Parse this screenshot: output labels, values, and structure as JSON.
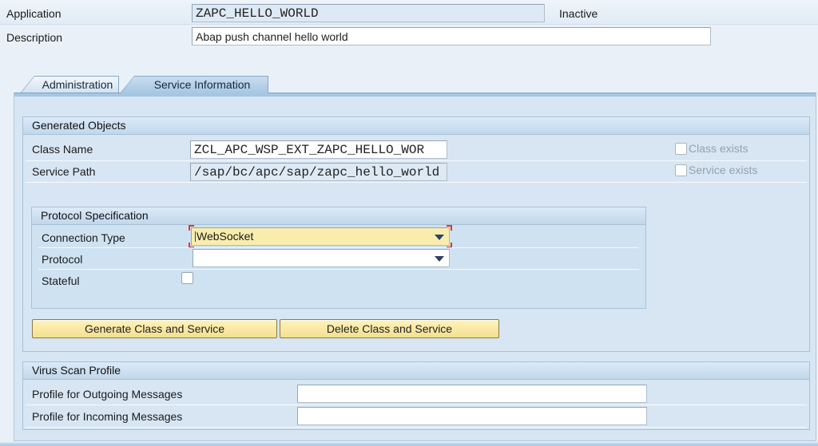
{
  "header": {
    "application_label": "Application",
    "application_value": "ZAPC_HELLO_WORLD",
    "status": "Inactive",
    "description_label": "Description",
    "description_value": "Abap push channel hello world"
  },
  "tabs": [
    {
      "label": "Administration",
      "active": false
    },
    {
      "label": "Service Information",
      "active": true
    }
  ],
  "generated_objects": {
    "title": "Generated Objects",
    "class_name_label": "Class Name",
    "class_name_value": "ZCL_APC_WSP_EXT_ZAPC_HELLO_WOR",
    "service_path_label": "Service Path",
    "service_path_value": "/sap/bc/apc/sap/zapc_hello_world",
    "class_exists_label": "Class exists",
    "class_exists_checked": false,
    "service_exists_label": "Service exists",
    "service_exists_checked": false
  },
  "protocol_specification": {
    "title": "Protocol Specification",
    "connection_type_label": "Connection Type",
    "connection_type_value": "WebSocket",
    "protocol_label": "Protocol",
    "protocol_value": "",
    "stateful_label": "Stateful",
    "stateful_checked": false
  },
  "actions": {
    "generate_label": "Generate Class and Service",
    "delete_label": "Delete Class and Service"
  },
  "virus_scan": {
    "title": "Virus Scan Profile",
    "outgoing_label": "Profile for Outgoing Messages",
    "outgoing_value": "",
    "incoming_label": "Profile for Incoming Messages",
    "incoming_value": ""
  },
  "colors": {
    "panel_bg": "#d8e6f3",
    "focus_field_bg": "#f9edad",
    "focus_bracket_red": "#e2382a",
    "button_yellow": "#f5df8e",
    "active_tab_blue": "#a6c6e2",
    "readonly_field_bg": "#dde9f4",
    "disabled_text": "#93a1af"
  }
}
